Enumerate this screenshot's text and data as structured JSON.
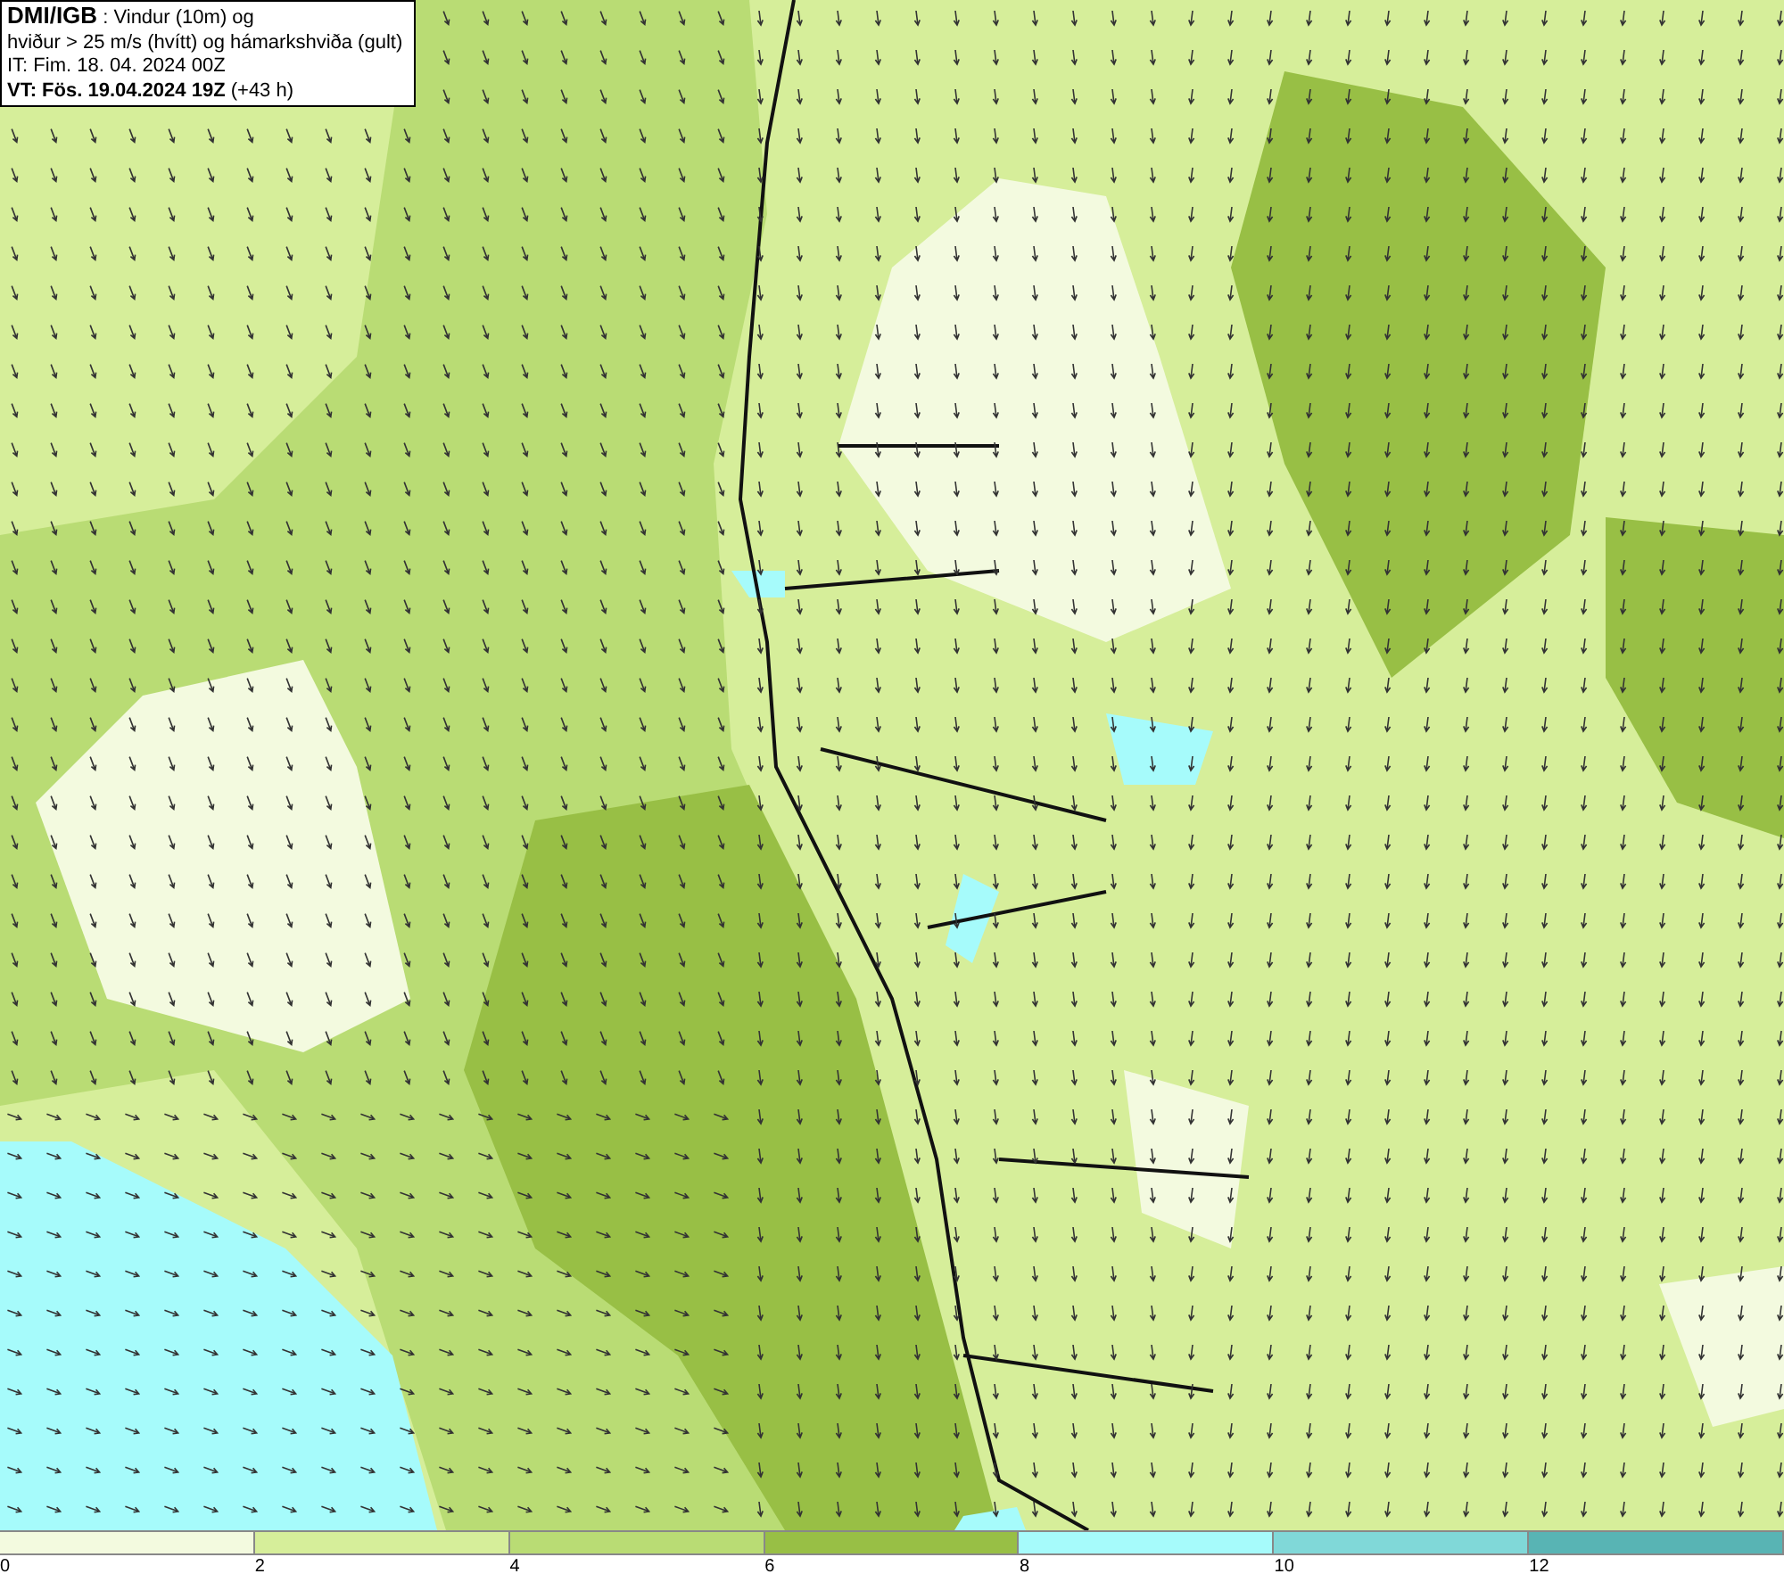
{
  "header": {
    "source": "DMI/IGB",
    "title": " : Vindur (10m) og",
    "subtitle": "hviður > 25 m/s (hvítt) og hámarkshviða (gult)",
    "initial_time": "IT: Fim. 18. 04. 2024 00Z",
    "valid_time": "VT: Fös. 19.04.2024 19Z",
    "lead": " (+43 h)"
  },
  "legend": {
    "bins": [
      {
        "color": "#f3fadf"
      },
      {
        "color": "#d6ee9a"
      },
      {
        "color": "#b9dc74"
      },
      {
        "color": "#98bf45"
      },
      {
        "color": "#a6fbfb"
      },
      {
        "color": "#80d8d8"
      },
      {
        "color": "#58b4b4"
      }
    ],
    "labels": [
      "0",
      "2",
      "4",
      "6",
      "8",
      "10",
      "12"
    ]
  }
}
